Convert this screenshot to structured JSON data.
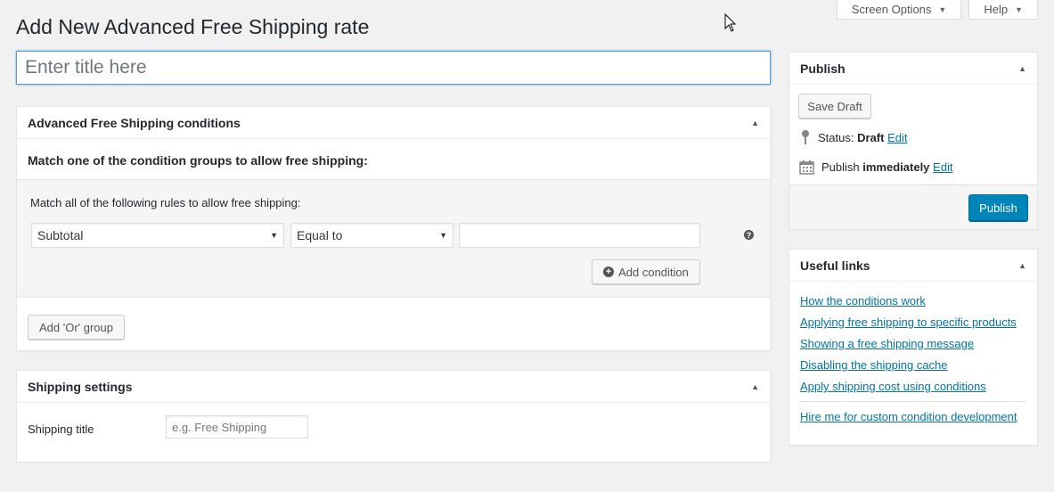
{
  "screen_meta": {
    "screen_options": "Screen Options",
    "help": "Help"
  },
  "page_title": "Add New Advanced Free Shipping rate",
  "title_input": {
    "placeholder": "Enter title here",
    "value": ""
  },
  "conditions_box": {
    "title": "Advanced Free Shipping conditions",
    "intro": "Match one of the condition groups to allow free shipping:",
    "group": {
      "rule_text": "Match all of the following rules to allow free shipping:",
      "condition_select": "Subtotal",
      "operator_select": "Equal to",
      "value_input": "",
      "add_condition": "Add condition"
    },
    "add_or_group": "Add 'Or' group"
  },
  "shipping_box": {
    "title": "Shipping settings",
    "label": "Shipping title",
    "placeholder": "e.g. Free Shipping"
  },
  "publish_box": {
    "title": "Publish",
    "save_draft": "Save Draft",
    "status_label": "Status:",
    "status_value": "Draft",
    "edit": "Edit",
    "publish_label": "Publish",
    "publish_value": "immediately",
    "publish_button": "Publish"
  },
  "links_box": {
    "title": "Useful links",
    "links": [
      "How the conditions work",
      "Applying free shipping to specific products",
      "Showing a free shipping message",
      "Disabling the shipping cache",
      "Apply shipping cost using conditions"
    ],
    "hire": "Hire me for custom condition development"
  },
  "colors": {
    "accent": "#0073aa",
    "primary_button": "#0085ba",
    "background": "#f1f1f1"
  }
}
